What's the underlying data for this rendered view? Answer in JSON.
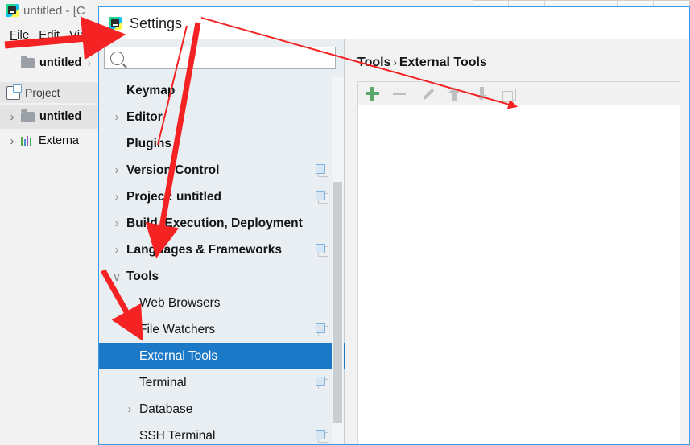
{
  "ide": {
    "title": "untitled - [C",
    "logo_icon": "pycharm-logo-icon",
    "menus": [
      {
        "underlined": "F",
        "rest": "ile"
      },
      {
        "underlined": "E",
        "rest": "dit"
      },
      {
        "underlined": "V",
        "rest": "ie"
      }
    ],
    "breadcrumb": {
      "folder_icon": "folder-icon",
      "label": "untitled",
      "chevron": "›"
    },
    "toolwindow": {
      "icon": "project-tool-window-icon",
      "label": "Project"
    },
    "project_tree": [
      {
        "chevron": "›",
        "icon": "folder-icon",
        "label": "untitled",
        "bold": true
      },
      {
        "chevron": "›",
        "icon": "external-libraries-icon",
        "label": "Externa",
        "bold": false
      }
    ]
  },
  "settings": {
    "title": "Settings",
    "logo_icon": "pycharm-logo-icon",
    "search": {
      "value": "",
      "placeholder": "",
      "icon": "search-icon"
    },
    "tree": [
      {
        "label": "Keymap",
        "level": 1,
        "chevron": "",
        "bold": true,
        "badge": false,
        "selected": false
      },
      {
        "label": "Editor",
        "level": 1,
        "chevron": "›",
        "bold": true,
        "badge": false,
        "selected": false
      },
      {
        "label": "Plugins",
        "level": 1,
        "chevron": "",
        "bold": true,
        "badge": false,
        "selected": false
      },
      {
        "label": "Version Control",
        "level": 1,
        "chevron": "›",
        "bold": true,
        "badge": true,
        "selected": false
      },
      {
        "label": "Project: untitled",
        "level": 1,
        "chevron": "›",
        "bold": true,
        "badge": true,
        "selected": false
      },
      {
        "label": "Build, Execution, Deployment",
        "level": 1,
        "chevron": "›",
        "bold": true,
        "badge": false,
        "selected": false
      },
      {
        "label": "Languages & Frameworks",
        "level": 1,
        "chevron": "›",
        "bold": true,
        "badge": true,
        "selected": false
      },
      {
        "label": "Tools",
        "level": 1,
        "chevron": "∨",
        "bold": true,
        "badge": false,
        "selected": false
      },
      {
        "label": "Web Browsers",
        "level": 2,
        "chevron": "",
        "bold": false,
        "badge": false,
        "selected": false
      },
      {
        "label": "File Watchers",
        "level": 2,
        "chevron": "",
        "bold": false,
        "badge": true,
        "selected": false
      },
      {
        "label": "External Tools",
        "level": 2,
        "chevron": "",
        "bold": false,
        "badge": false,
        "selected": true
      },
      {
        "label": "Terminal",
        "level": 2,
        "chevron": "",
        "bold": false,
        "badge": true,
        "selected": false
      },
      {
        "label": "Database",
        "level": 2,
        "chevron": "›",
        "bold": false,
        "badge": false,
        "selected": false
      },
      {
        "label": "SSH Terminal",
        "level": 2,
        "chevron": "",
        "bold": false,
        "badge": true,
        "selected": false
      }
    ],
    "content": {
      "breadcrumb_parent": "Tools",
      "breadcrumb_sep": "›",
      "breadcrumb_current": "External Tools",
      "toolbar": [
        {
          "name": "add-button",
          "icon": "plus-icon",
          "enabled": true
        },
        {
          "name": "remove-button",
          "icon": "minus-icon",
          "enabled": false
        },
        {
          "name": "edit-button",
          "icon": "pencil-icon",
          "enabled": false
        },
        {
          "name": "move-up-button",
          "icon": "arrow-up-icon",
          "enabled": false
        },
        {
          "name": "move-down-button",
          "icon": "arrow-down-icon",
          "enabled": false
        },
        {
          "name": "copy-button",
          "icon": "copy-icon",
          "enabled": false
        }
      ],
      "list_items": []
    }
  },
  "colors": {
    "selection_blue": "#1B79C8",
    "dialog_border_blue": "#3C9BE8",
    "tree_bg": "#E9EEF2",
    "annotation_red": "#F42222",
    "plus_green": "#59A869"
  }
}
